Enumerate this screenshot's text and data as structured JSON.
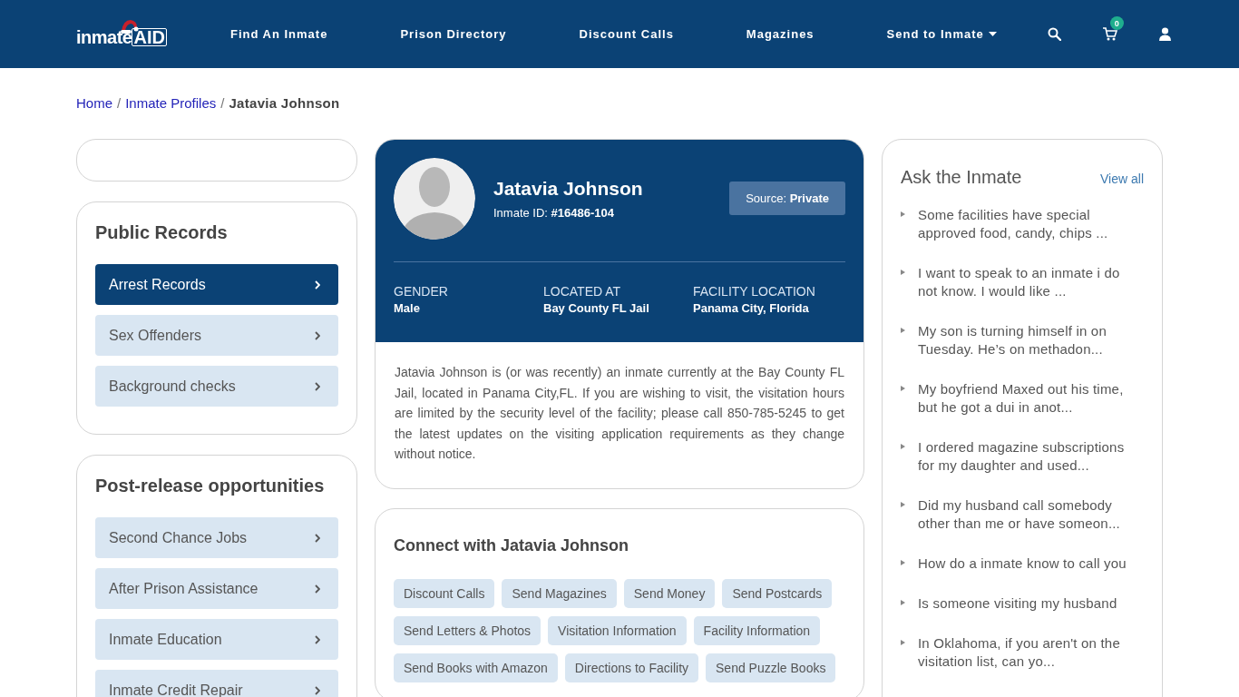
{
  "header": {
    "logo": {
      "part_1": "inmate",
      "part_2": "AID"
    },
    "nav": [
      {
        "label": "Find An Inmate",
        "dropdown": false
      },
      {
        "label": "Prison Directory",
        "dropdown": false
      },
      {
        "label": "Discount Calls",
        "dropdown": false
      },
      {
        "label": "Magazines",
        "dropdown": false
      },
      {
        "label": "Send to Inmate",
        "dropdown": true
      }
    ],
    "cart_count": "0"
  },
  "breadcrumb_separator": "/",
  "breadcrumb": [
    {
      "label": "Home",
      "current": false
    },
    {
      "label": "Inmate Profiles",
      "current": false
    },
    {
      "label": "Jatavia Johnson",
      "current": true
    }
  ],
  "sidebar": {
    "sections": [
      {
        "title": "Public Records",
        "items": [
          {
            "label": "Arrest Records",
            "selected": true
          },
          {
            "label": "Sex Offenders",
            "selected": false
          },
          {
            "label": "Background checks",
            "selected": false
          }
        ]
      },
      {
        "title": "Post-release opportunities",
        "items": [
          {
            "label": "Second Chance Jobs",
            "selected": false
          },
          {
            "label": "After Prison Assistance",
            "selected": false
          },
          {
            "label": "Inmate Education",
            "selected": false
          },
          {
            "label": "Inmate Credit Repair",
            "selected": false
          }
        ]
      }
    ]
  },
  "profile": {
    "name": "Jatavia Johnson",
    "inmate_id": "Inmate ID: **#16486-104**",
    "source": "Source: **Private**",
    "facts": [
      {
        "label": "GENDER",
        "value": "Male"
      },
      {
        "label": "LOCATED AT",
        "value": "Bay County FL Jail"
      },
      {
        "label": "FACILITY LOCATION",
        "value": "Panama City, Florida"
      }
    ],
    "description": "Jatavia Johnson is (or was recently) an inmate currently at the Bay County FL Jail, located in Panama City,FL. If you are wishing to visit, the visitation hours are limited by the security level of the facility; please call 850-785-5245 to get the latest updates on the visiting application requirements as they change without notice."
  },
  "connect": {
    "title": "Connect with Jatavia Johnson",
    "links": [
      "Discount Calls",
      "Send Magazines",
      "Send Money",
      "Send Postcards",
      "Send Letters & Photos",
      "Visitation Information",
      "Facility Information",
      "Send Books with Amazon",
      "Directions to Facility",
      "Send Puzzle Books"
    ]
  },
  "ask": {
    "title": "Ask the Inmate",
    "view_all": "View all",
    "questions": [
      "Some facilities have special approved food, candy, chips ...",
      "I want to speak to an inmate i do not know. I would like ...",
      "My son is turning himself in on Tuesday. He’s on methadon...",
      "My boyfriend Maxed out his time, but he got a dui in anot...",
      "I ordered magazine subscriptions for my daughter and used...",
      "Did my husband call somebody other than me or have someon...",
      "How do a inmate know to call you",
      "Is someone visiting my husband",
      "In Oklahoma, if you aren't on the visitation list, can yo..."
    ]
  }
}
